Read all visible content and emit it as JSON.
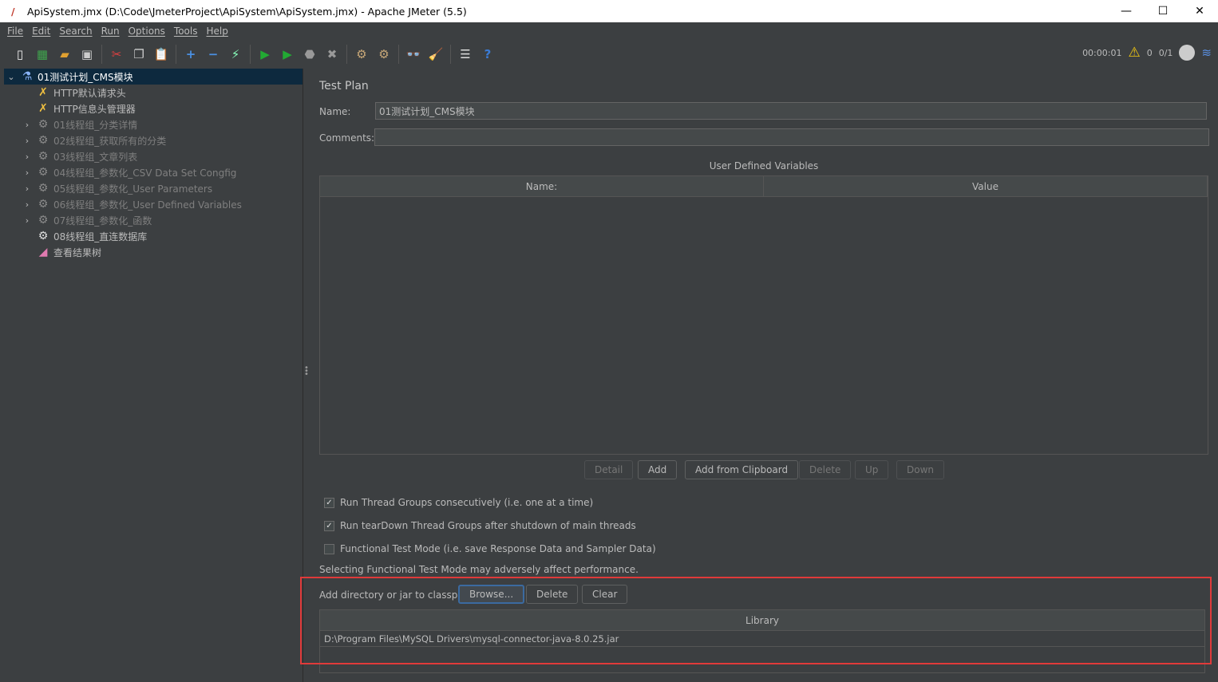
{
  "window": {
    "title": "ApiSystem.jmx (D:\\Code\\JmeterProject\\ApiSystem\\ApiSystem.jmx) - Apache JMeter (5.5)",
    "minimize": "—",
    "maximize": "☐",
    "close": "✕"
  },
  "menu": [
    "File",
    "Edit",
    "Search",
    "Run",
    "Options",
    "Tools",
    "Help"
  ],
  "toolbar": [
    {
      "name": "new-icon",
      "glyph": "▯",
      "color": "#eeeeee"
    },
    {
      "name": "templates-icon",
      "glyph": "▦",
      "color": "#3fa34d"
    },
    {
      "name": "open-icon",
      "glyph": "▰",
      "color": "#e0a030"
    },
    {
      "name": "save-icon",
      "glyph": "▣",
      "color": "#cccccc"
    },
    {
      "sep": true
    },
    {
      "name": "cut-icon",
      "glyph": "✂",
      "color": "#e04040"
    },
    {
      "name": "copy-icon",
      "glyph": "❐",
      "color": "#cccccc"
    },
    {
      "name": "paste-icon",
      "glyph": "📋",
      "color": "#c9a060"
    },
    {
      "sep": true
    },
    {
      "name": "expand-icon",
      "glyph": "+",
      "color": "#4a90e2"
    },
    {
      "name": "collapse-icon",
      "glyph": "−",
      "color": "#4a90e2"
    },
    {
      "name": "toggle-icon",
      "glyph": "⚡",
      "color": "#8fb"
    },
    {
      "sep": true
    },
    {
      "name": "start-icon",
      "glyph": "▶",
      "color": "#22aa33"
    },
    {
      "name": "start-no-pauses-icon",
      "glyph": "▶",
      "color": "#22aa33"
    },
    {
      "name": "stop-icon",
      "glyph": "⬣",
      "color": "#999999"
    },
    {
      "name": "shutdown-icon",
      "glyph": "✖",
      "color": "#999999"
    },
    {
      "sep": true
    },
    {
      "name": "clear-icon",
      "glyph": "⚙",
      "color": "#c8a878"
    },
    {
      "name": "clear-all-icon",
      "glyph": "⚙",
      "color": "#c8a878"
    },
    {
      "sep": true
    },
    {
      "name": "search-icon",
      "glyph": "👓",
      "color": "#dddddd"
    },
    {
      "name": "reset-search-icon",
      "glyph": "🧹",
      "color": "#f0c020"
    },
    {
      "sep": true
    },
    {
      "name": "function-helper-icon",
      "glyph": "☰",
      "color": "#dddddd"
    },
    {
      "name": "help-icon",
      "glyph": "?",
      "color": "#3a7bd5"
    }
  ],
  "status": {
    "timer": "00:00:01",
    "warnings": "0",
    "threads": "0/1"
  },
  "tree": [
    {
      "label": "01测试计划_CMS模块",
      "icon": "flask-icon",
      "arrow": "⌄",
      "selected": true,
      "disabled": false,
      "indent": 0
    },
    {
      "label": "HTTP默认请求头",
      "icon": "wrench-icon",
      "arrow": "",
      "disabled": false,
      "indent": 1
    },
    {
      "label": "HTTP信息头管理器",
      "icon": "wrench-icon",
      "arrow": "",
      "disabled": false,
      "indent": 1
    },
    {
      "label": "01线程组_分类详情",
      "icon": "gear-icon",
      "arrow": "›",
      "disabled": true,
      "indent": 1
    },
    {
      "label": "02线程组_获取所有的分类",
      "icon": "gear-icon",
      "arrow": "›",
      "disabled": true,
      "indent": 1
    },
    {
      "label": "03线程组_文章列表",
      "icon": "gear-icon",
      "arrow": "›",
      "disabled": true,
      "indent": 1
    },
    {
      "label": "04线程组_参数化_CSV Data Set Congfig",
      "icon": "gear-icon",
      "arrow": "›",
      "disabled": true,
      "indent": 1
    },
    {
      "label": "05线程组_参数化_User Parameters",
      "icon": "gear-icon",
      "arrow": "›",
      "disabled": true,
      "indent": 1
    },
    {
      "label": "06线程组_参数化_User Defined Variables",
      "icon": "gear-icon",
      "arrow": "›",
      "disabled": true,
      "indent": 1
    },
    {
      "label": "07线程组_参数化_函数",
      "icon": "gear-icon",
      "arrow": "›",
      "disabled": true,
      "indent": 1
    },
    {
      "label": "08线程组_直连数据库",
      "icon": "gear-icon",
      "arrow": "",
      "disabled": false,
      "indent": 1
    },
    {
      "label": "查看结果树",
      "icon": "chart-icon",
      "arrow": "",
      "disabled": false,
      "indent": 1
    }
  ],
  "panel": {
    "title": "Test Plan",
    "name_label": "Name:",
    "name_value": "01测试计划_CMS模块",
    "comments_label": "Comments:",
    "comments_value": "",
    "udv_title": "User Defined Variables",
    "udv_columns": [
      "Name:",
      "Value"
    ],
    "buttons": {
      "detail": "Detail",
      "add": "Add",
      "add_clipboard": "Add from Clipboard",
      "delete": "Delete",
      "up": "Up",
      "down": "Down"
    },
    "options": [
      {
        "label": "Run Thread Groups consecutively (i.e. one at a time)",
        "checked": true
      },
      {
        "label": "Run tearDown Thread Groups after shutdown of main threads",
        "checked": true
      },
      {
        "label": "Functional Test Mode (i.e. save Response Data and Sampler Data)",
        "checked": false
      }
    ],
    "functional_note": "Selecting Functional Test Mode may adversely affect performance.",
    "classpath_label": "Add directory or jar to classpath",
    "classpath_buttons": {
      "browse": "Browse...",
      "delete": "Delete",
      "clear": "Clear"
    },
    "library_header": "Library",
    "libraries": [
      "D:\\Program Files\\MySQL Drivers\\mysql-connector-java-8.0.25.jar"
    ]
  },
  "highlight_color": "#e03a3a"
}
